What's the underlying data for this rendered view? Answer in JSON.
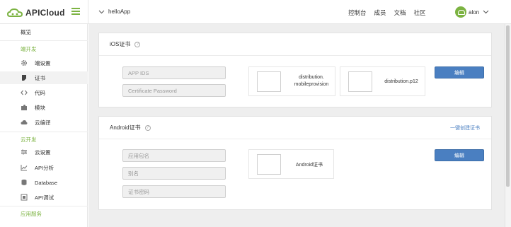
{
  "brand": {
    "name": "APICloud"
  },
  "header": {
    "app_name": "helloApp",
    "nav": [
      "控制台",
      "成员",
      "文档",
      "社区"
    ],
    "user_name": "alon"
  },
  "sidebar": {
    "overview": "概览",
    "section_dev": "端开发",
    "dev_items": [
      {
        "label": "端设置",
        "icon": "gear-icon"
      },
      {
        "label": "证书",
        "icon": "certificate-icon"
      },
      {
        "label": "代码",
        "icon": "code-icon"
      },
      {
        "label": "模块",
        "icon": "puzzle-icon"
      },
      {
        "label": "云编译",
        "icon": "cloud-icon"
      }
    ],
    "section_cloud": "云开发",
    "cloud_items": [
      {
        "label": "云设置",
        "icon": "sliders-icon"
      },
      {
        "label": "API分析",
        "icon": "line-chart-icon"
      },
      {
        "label": "Database",
        "icon": "database-icon"
      },
      {
        "label": "API调试",
        "icon": "debug-icon"
      }
    ],
    "section_services": "应用服务"
  },
  "ios_panel": {
    "title": "iOS证书",
    "app_ids_placeholder": "APP IDS",
    "cert_password_placeholder": "Certificate Password",
    "upload_provision_label_1": "distribution.",
    "upload_provision_label_2": "mobileprovision",
    "upload_p12_label": "distribution.p12",
    "edit_label": "编辑"
  },
  "android_panel": {
    "title": "Android证书",
    "create_link": "一键创建证书",
    "package_placeholder": "应用包名",
    "alias_placeholder": "别名",
    "password_placeholder": "证书密码",
    "upload_label": "Android证书",
    "edit_label": "编辑"
  },
  "colors": {
    "accent": "#7cb342",
    "primary_button": "#4a7fc1",
    "link": "#4a7fc1"
  }
}
